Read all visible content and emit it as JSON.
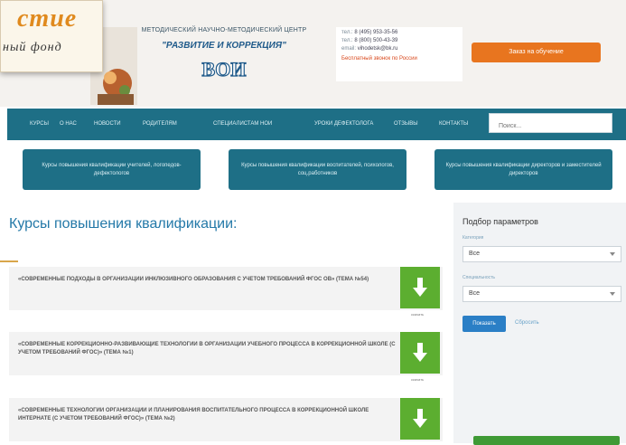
{
  "header": {
    "logo_title": "стие",
    "logo_subtitle": "ный фонд",
    "org_line": "МЕТОДИЧЕСКИЙ НАУЧНО-МЕТОДИЧЕСКИЙ ЦЕНТР",
    "org_name": "\"РАЗВИТИЕ И КОРРЕКЦИЯ\"",
    "logo_mark": "ВОИ",
    "contacts": [
      {
        "key": "тел.:",
        "value": "8 (495) 953-35-56"
      },
      {
        "key": "тел.:",
        "value": "8 (800) 500-43-39"
      },
      {
        "key": "email:",
        "value": "vihodetsk@bk.ru"
      }
    ],
    "free_call": "Бесплатный звонок по России",
    "cta_label": "Заказ на обучение"
  },
  "nav": {
    "items": [
      "КУРСЫ",
      "О НАС",
      "НОВОСТИ",
      "РОДИТЕЛЯМ",
      "СПЕЦИАЛИСТАМ НОИ",
      "УРОКИ ДЕФЕКТОЛОГА",
      "ОТЗЫВЫ",
      "КОНТАКТЫ"
    ],
    "search_placeholder": "Поиск..."
  },
  "categories": [
    "Курсы повышения квалификации учителей, логопедов-дефектологов",
    "Курсы повышения квалификации воспитателей, психологов, соц.работников",
    "Курсы повышения квалификации директоров и заместителей директоров"
  ],
  "main": {
    "title": "Курсы повышения квалификации:",
    "courses": [
      {
        "text": "«СОВРЕМЕННЫЕ ПОДХОДЫ В ОРГАНИЗАЦИИ ИНКЛЮЗИВНОГО ОБРАЗОВАНИЯ С УЧЕТОМ ТРЕБОВАНИЙ ФГОС ОВ» (ТЕМА №54)",
        "caption": "скачать"
      },
      {
        "text": "«СОВРЕМЕННЫЕ КОРРЕКЦИОННО-РАЗВИВАЮЩИЕ ТЕХНОЛОГИИ В ОРГАНИЗАЦИИ УЧЕБНОГО ПРОЦЕССА В КОРРЕКЦИОННОЙ ШКОЛЕ (С УЧЕТОМ ТРЕБОВАНИЙ ФГОС)» (ТЕМА №1)",
        "caption": "скачать"
      },
      {
        "text": "«СОВРЕМЕННЫЕ ТЕХНОЛОГИИ ОРГАНИЗАЦИИ И ПЛАНИРОВАНИЯ ВОСПИТАТЕЛЬНОГО ПРОЦЕССА В КОРРЕКЦИОННОЙ ШКОЛЕ ИНТЕРНАТЕ (С УЧЕТОМ ТРЕБОВАНИЙ ФГОС)» (ТЕМА №2)",
        "caption": "скачать"
      }
    ]
  },
  "sidebar": {
    "title": "Подбор параметров",
    "filter1_label": "Категория",
    "filter1_value": "Все",
    "filter2_label": "Специальность",
    "filter2_value": "Все",
    "apply_label": "Показать",
    "reset_label": "Сбросить"
  },
  "colors": {
    "nav_bg": "#1e6f86",
    "cta": "#e8751f",
    "download": "#5cae30",
    "title": "#2479a8"
  }
}
